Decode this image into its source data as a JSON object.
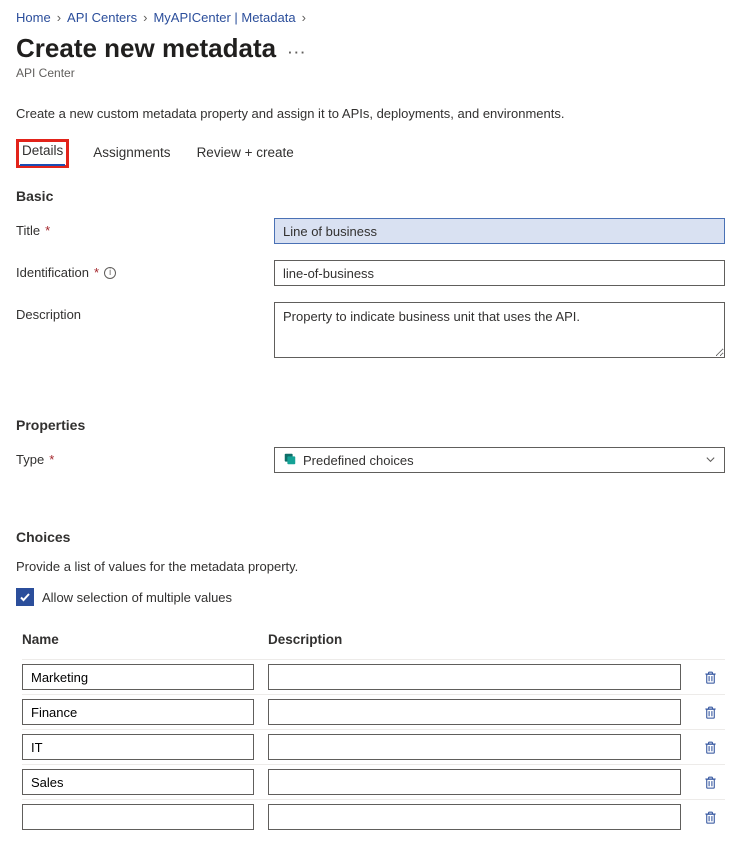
{
  "breadcrumb": {
    "items": [
      "Home",
      "API Centers",
      "MyAPICenter | Metadata"
    ]
  },
  "header": {
    "title": "Create new metadata",
    "subtitle": "API Center"
  },
  "intro": "Create a new custom metadata property and assign it to APIs, deployments, and environments.",
  "tabs": {
    "items": [
      {
        "label": "Details",
        "active": true
      },
      {
        "label": "Assignments",
        "active": false
      },
      {
        "label": "Review + create",
        "active": false
      }
    ]
  },
  "sections": {
    "basic": {
      "title": "Basic",
      "fields": {
        "title": {
          "label": "Title",
          "value": "Line of business",
          "required": true
        },
        "identification": {
          "label": "Identification",
          "value": "line-of-business",
          "required": true
        },
        "description": {
          "label": "Description",
          "value": "Property to indicate business unit that uses the API."
        }
      }
    },
    "properties": {
      "title": "Properties",
      "type": {
        "label": "Type",
        "value": "Predefined choices",
        "required": true
      }
    },
    "choices": {
      "title": "Choices",
      "description": "Provide a list of values for the metadata property.",
      "allowMultiple": {
        "label": "Allow selection of multiple values",
        "checked": true
      },
      "columns": {
        "name": "Name",
        "description": "Description"
      },
      "rows": [
        {
          "name": "Marketing",
          "description": ""
        },
        {
          "name": "Finance",
          "description": ""
        },
        {
          "name": "IT",
          "description": ""
        },
        {
          "name": "Sales",
          "description": ""
        },
        {
          "name": "",
          "description": ""
        }
      ]
    }
  }
}
